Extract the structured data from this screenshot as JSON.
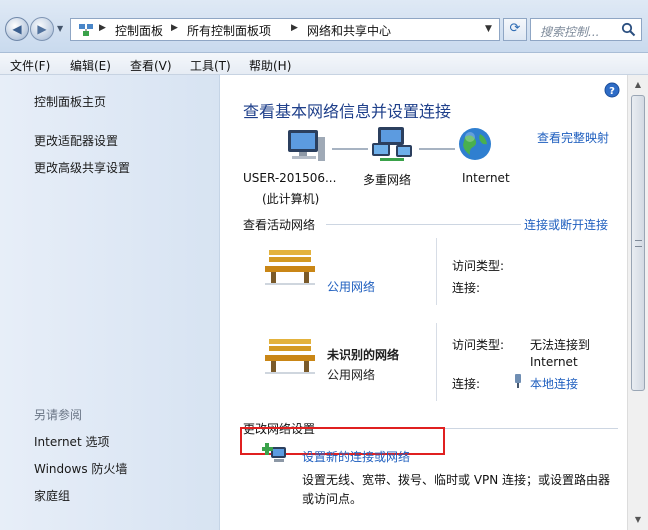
{
  "address": {
    "crumbs": [
      "控制面板",
      "所有控制面板项",
      "网络和共享中心"
    ],
    "search_placeholder": "搜索控制..."
  },
  "menu": [
    "文件(F)",
    "编辑(E)",
    "查看(V)",
    "工具(T)",
    "帮助(H)"
  ],
  "sidebar": {
    "links": [
      "控制面板主页",
      "更改适配器设置",
      "更改高级共享设置"
    ],
    "see_also_heading": "另请参阅",
    "see_also": [
      "Internet 选项",
      "Windows 防火墙",
      "家庭组"
    ]
  },
  "main": {
    "title": "查看基本网络信息并设置连接",
    "full_map_link": "查看完整映射",
    "map_nodes": [
      {
        "label": "USER-201506...",
        "sub": "(此计算机)",
        "icon": "computer-icon"
      },
      {
        "label": "多重网络",
        "icon": "multiple-networks-icon"
      },
      {
        "label": "Internet",
        "icon": "globe-icon"
      }
    ],
    "active_heading": "查看活动网络",
    "connect_link": "连接或断开连接",
    "networks": [
      {
        "name": "",
        "type_link": "公用网络",
        "access_label": "访问类型:",
        "access_value": "",
        "conn_label": "连接:",
        "conn_value": "",
        "icon": "bench-icon"
      },
      {
        "name": "未识别的网络",
        "type": "公用网络",
        "access_label": "访问类型:",
        "access_value_1": "无法连接到",
        "access_value_2": "Internet",
        "conn_label": "连接:",
        "conn_link": "本地连接",
        "icon": "bench-icon"
      }
    ],
    "change_heading": "更改网络设置",
    "setup_link": "设置新的连接或网络",
    "setup_desc": "设置无线、宽带、拨号、临时或 VPN 连接；或设置路由器或访问点。"
  },
  "colors": {
    "link": "#1f5fbf",
    "title": "#1e3f8a",
    "highlight": "#e02020"
  }
}
